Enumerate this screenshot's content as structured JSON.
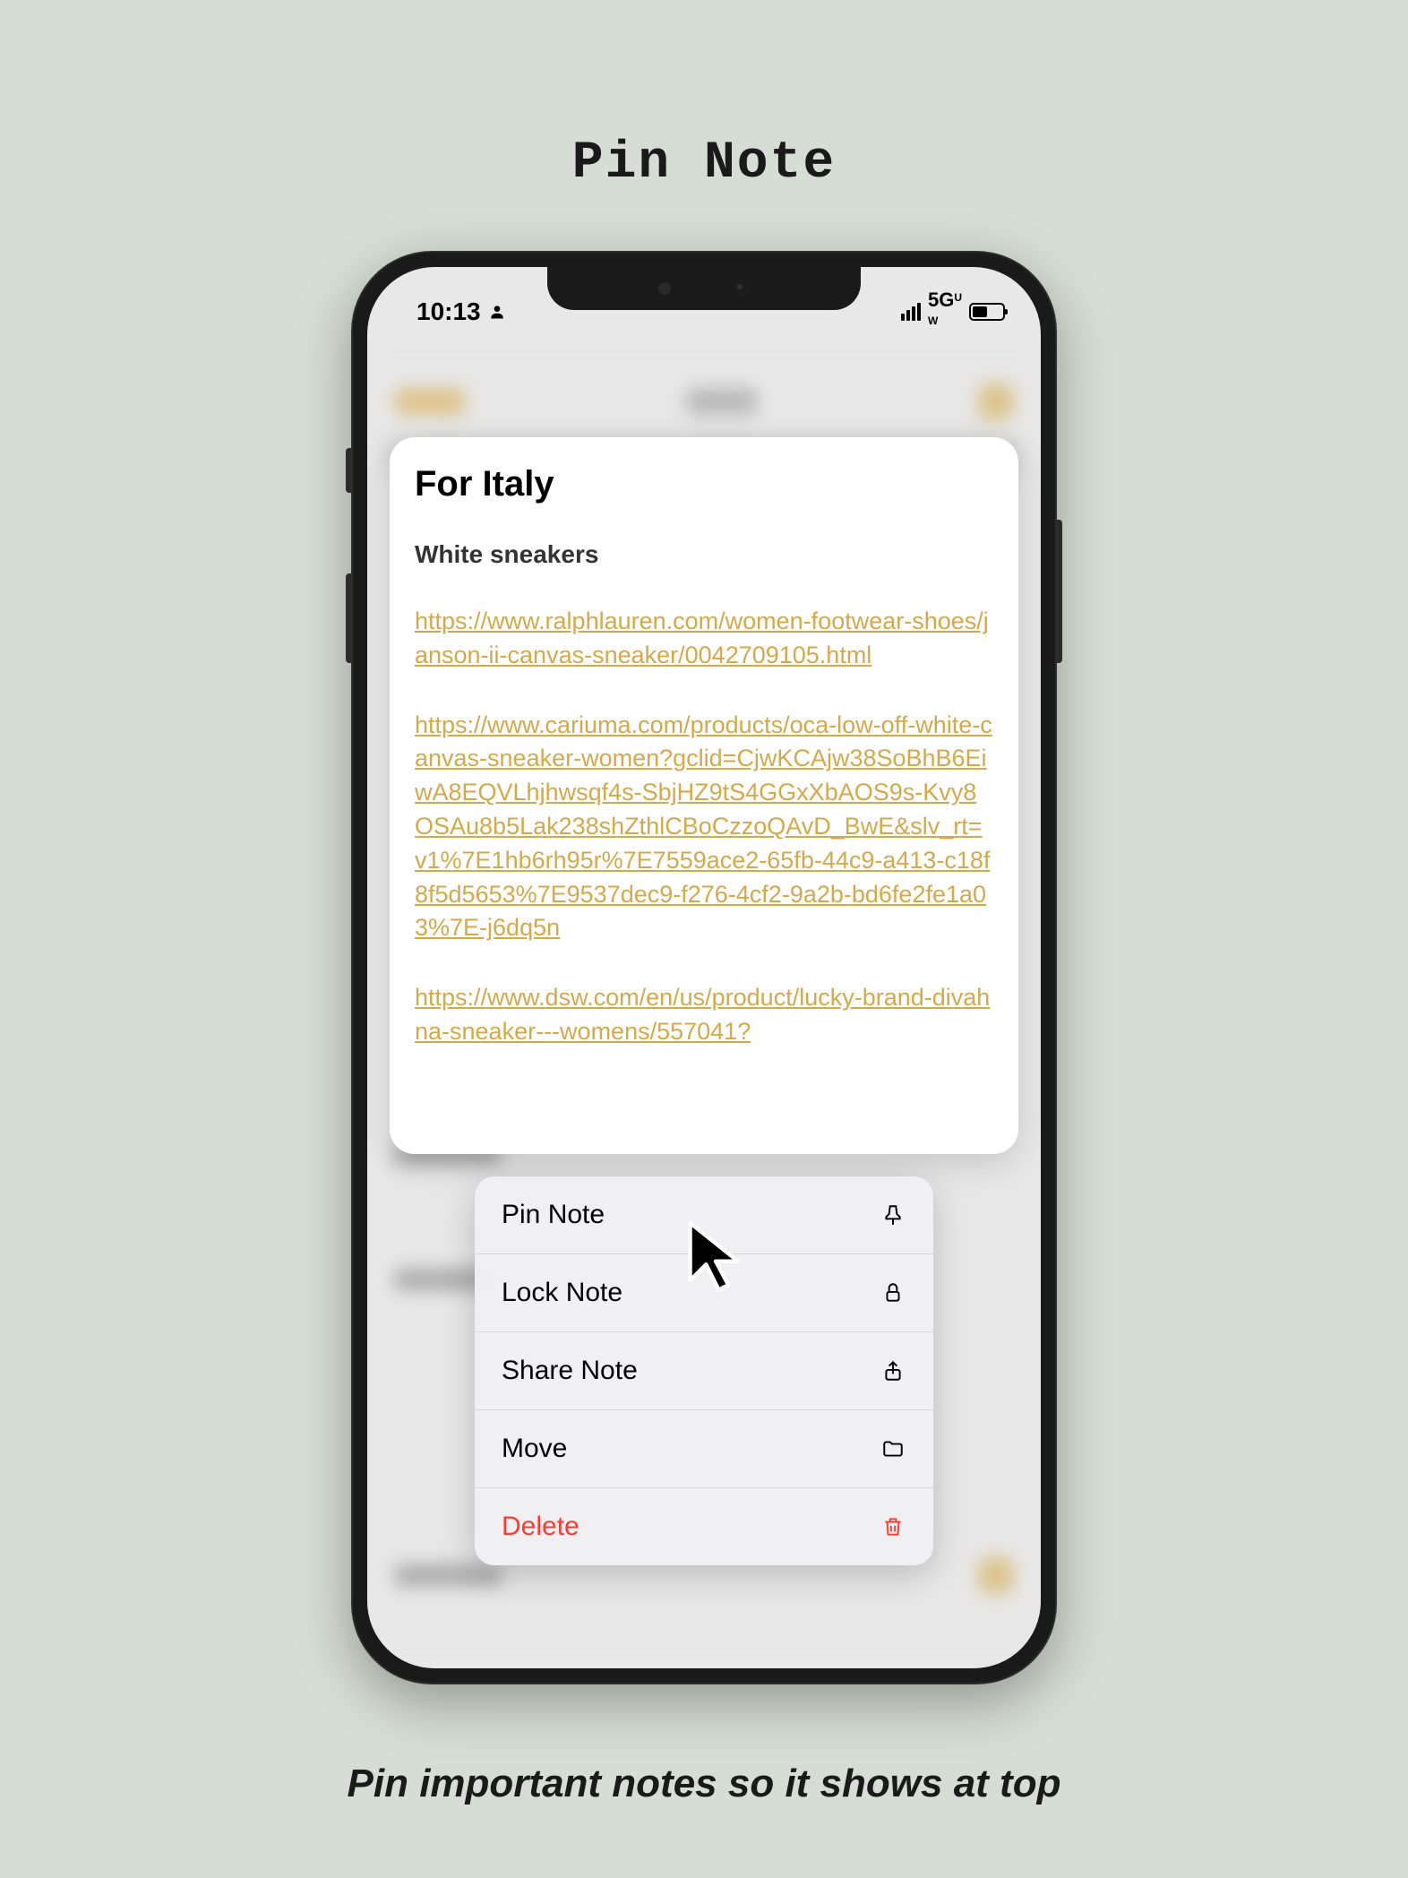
{
  "page": {
    "title": "Pin Note",
    "caption": "Pin important notes so it shows at top"
  },
  "status_bar": {
    "time": "10:13",
    "network": "5G",
    "network_sub": "U\nW"
  },
  "note": {
    "title": "For Italy",
    "subtitle": "White sneakers",
    "links": [
      "https://www.ralphlauren.com/women-footwear-shoes/janson-ii-canvas-sneaker/0042709105.html",
      "https://www.cariuma.com/products/oca-low-off-white-canvas-sneaker-women?gclid=CjwKCAjw38SoBhB6EiwA8EQVLhjhwsqf4s-SbjHZ9tS4GGxXbAOS9s-Kvy8OSAu8b5Lak238shZthlCBoCzzoQAvD_BwE&slv_rt=v1%7E1hb6rh95r%7E7559ace2-65fb-44c9-a413-c18f8f5d5653%7E9537dec9-f276-4cf2-9a2b-bd6fe2fe1a03%7E-j6dq5n",
      "https://www.dsw.com/en/us/product/lucky-brand-divahna-sneaker---womens/557041?"
    ]
  },
  "context_menu": {
    "items": [
      {
        "label": "Pin Note",
        "icon": "pin-icon",
        "destructive": false
      },
      {
        "label": "Lock Note",
        "icon": "lock-icon",
        "destructive": false
      },
      {
        "label": "Share Note",
        "icon": "share-icon",
        "destructive": false
      },
      {
        "label": "Move",
        "icon": "folder-icon",
        "destructive": false
      },
      {
        "label": "Delete",
        "icon": "trash-icon",
        "destructive": true
      }
    ]
  }
}
